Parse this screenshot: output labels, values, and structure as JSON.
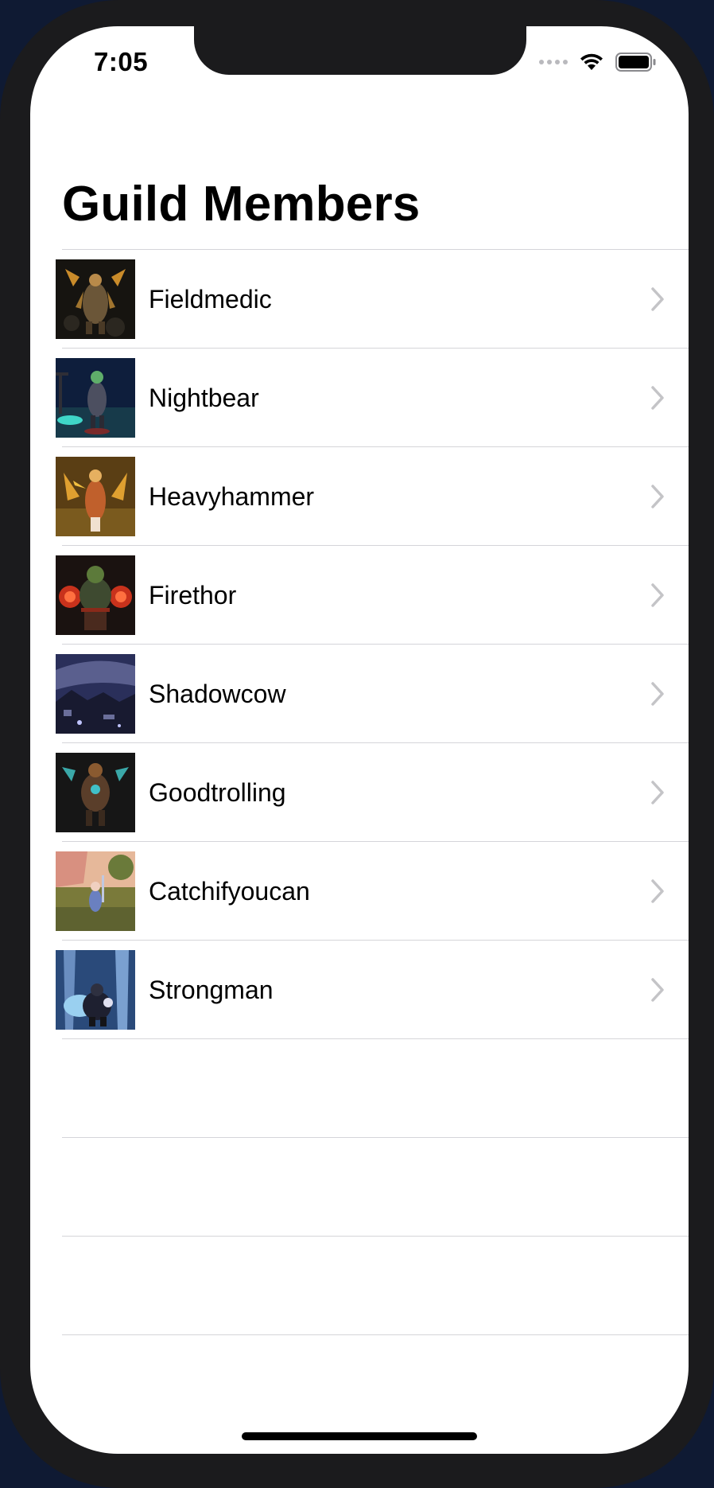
{
  "status_bar": {
    "time": "7:05",
    "signal_icon": "signal-dots-icon",
    "wifi_icon": "wifi-icon",
    "battery_icon": "battery-icon"
  },
  "header": {
    "title": "Guild Members"
  },
  "members": [
    {
      "name": "Fieldmedic",
      "avatar": "character-portrait",
      "chevron": "chevron-right-icon"
    },
    {
      "name": "Nightbear",
      "avatar": "character-portrait",
      "chevron": "chevron-right-icon"
    },
    {
      "name": "Heavyhammer",
      "avatar": "character-portrait",
      "chevron": "chevron-right-icon"
    },
    {
      "name": "Firethor",
      "avatar": "character-portrait",
      "chevron": "chevron-right-icon"
    },
    {
      "name": "Shadowcow",
      "avatar": "character-portrait",
      "chevron": "chevron-right-icon"
    },
    {
      "name": "Goodtrolling",
      "avatar": "character-portrait",
      "chevron": "chevron-right-icon"
    },
    {
      "name": "Catchifyoucan",
      "avatar": "character-portrait",
      "chevron": "chevron-right-icon"
    },
    {
      "name": "Strongman",
      "avatar": "character-portrait",
      "chevron": "chevron-right-icon"
    }
  ],
  "colors": {
    "separator": "#d5d5d9",
    "chevron": "#c4c4c7",
    "bezel": "#1b1b1d"
  }
}
